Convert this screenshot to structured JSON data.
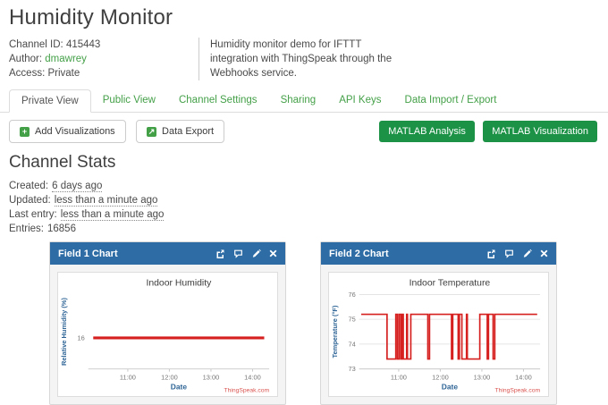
{
  "header": {
    "title": "Humidity Monitor",
    "channel_id_label": "Channel ID:",
    "channel_id": "415443",
    "author_label": "Author:",
    "author": "dmawrey",
    "access_label": "Access:",
    "access": "Private",
    "description": "Humidity monitor demo for IFTTT integration with ThingSpeak through the Webhooks service."
  },
  "tabs": [
    {
      "label": "Private View",
      "active": true
    },
    {
      "label": "Public View",
      "active": false
    },
    {
      "label": "Channel Settings",
      "active": false
    },
    {
      "label": "Sharing",
      "active": false
    },
    {
      "label": "API Keys",
      "active": false
    },
    {
      "label": "Data Import / Export",
      "active": false
    }
  ],
  "toolbar": {
    "add_visualizations_label": "Add Visualizations",
    "add_visualizations_icon": "plus-icon",
    "data_export_label": "Data Export",
    "data_export_icon": "export-icon",
    "export_glyph": "↗",
    "plus_glyph": "+",
    "matlab_analysis_label": "MATLAB Analysis",
    "matlab_visualization_label": "MATLAB Visualization"
  },
  "stats": {
    "heading": "Channel Stats",
    "rows": [
      {
        "label": "Created:",
        "value": "6 days ago"
      },
      {
        "label": "Updated:",
        "value": "less than a minute ago"
      },
      {
        "label": "Last entry:",
        "value": "less than a minute ago"
      },
      {
        "label": "Entries:",
        "value": "16856",
        "plain": true
      }
    ]
  },
  "panels": [
    {
      "title": "Field 1 Chart",
      "icons": [
        "popout-icon",
        "comment-icon",
        "edit-icon",
        "close-icon"
      ]
    },
    {
      "title": "Field 2 Chart",
      "icons": [
        "popout-icon",
        "comment-icon",
        "edit-icon",
        "close-icon"
      ]
    }
  ],
  "colors": {
    "accent_green": "#44a048",
    "button_green": "#1b9246",
    "panel_header_blue": "#2d6ca5",
    "chart_line_red": "#d62020",
    "axis_label_blue": "#2f6596",
    "credit_red": "#d9534f"
  },
  "chart_data": [
    {
      "type": "line",
      "title": "Indoor Humidity",
      "xlabel": "Date",
      "ylabel": "Relative Humidity (%)",
      "credit": "ThingSpeak.com",
      "xlim": [
        10.05,
        14.4
      ],
      "ylim": [
        14.75,
        17.75
      ],
      "x_ticks": [
        {
          "value": 11,
          "label": "11:00"
        },
        {
          "value": 12,
          "label": "12:00"
        },
        {
          "value": 13,
          "label": "13:00"
        },
        {
          "value": 14,
          "label": "14:00"
        }
      ],
      "y_ticks": [
        16
      ],
      "y_gridlines": [],
      "grid": false,
      "legend": "none",
      "line_color": "#d62020",
      "axis_color": "#2f6596",
      "credit_color": "#d9534f",
      "line_width": 3.2,
      "series": [
        {
          "name": "Relative Humidity (%)",
          "points": [
            [
              10.17,
              16
            ],
            [
              14.28,
              16
            ]
          ]
        }
      ]
    },
    {
      "type": "line",
      "title": "Indoor Temperature",
      "xlabel": "Date",
      "ylabel": "Temperature (°F)",
      "credit": "ThingSpeak.com",
      "xlim": [
        10.05,
        14.4
      ],
      "ylim": [
        73,
        76
      ],
      "x_ticks": [
        {
          "value": 11,
          "label": "11:00"
        },
        {
          "value": 12,
          "label": "12:00"
        },
        {
          "value": 13,
          "label": "13:00"
        },
        {
          "value": 14,
          "label": "14:00"
        }
      ],
      "y_ticks": [
        73,
        74,
        75,
        76
      ],
      "y_gridlines": [
        73,
        74,
        75,
        76
      ],
      "grid": true,
      "legend": "none",
      "line_color": "#d62020",
      "axis_color": "#2f6596",
      "credit_color": "#d9534f",
      "line_width": 1.7,
      "series": [
        {
          "name": "Temperature (°F)",
          "points": [
            [
              10.1,
              75.2
            ],
            [
              10.72,
              75.2
            ],
            [
              10.72,
              73.4
            ],
            [
              10.93,
              73.4
            ],
            [
              10.93,
              75.2
            ],
            [
              10.97,
              75.2
            ],
            [
              10.97,
              73.4
            ],
            [
              11.01,
              73.4
            ],
            [
              11.01,
              75.2
            ],
            [
              11.05,
              75.2
            ],
            [
              11.05,
              73.4
            ],
            [
              11.08,
              73.4
            ],
            [
              11.08,
              75.2
            ],
            [
              11.11,
              75.2
            ],
            [
              11.11,
              73.4
            ],
            [
              11.19,
              73.4
            ],
            [
              11.19,
              75.2
            ],
            [
              11.21,
              75.2
            ],
            [
              11.21,
              73.4
            ],
            [
              11.29,
              73.4
            ],
            [
              11.29,
              75.2
            ],
            [
              11.7,
              75.2
            ],
            [
              11.7,
              73.4
            ],
            [
              11.74,
              73.4
            ],
            [
              11.74,
              75.2
            ],
            [
              12.27,
              75.2
            ],
            [
              12.27,
              73.4
            ],
            [
              12.3,
              73.4
            ],
            [
              12.3,
              75.2
            ],
            [
              12.43,
              75.2
            ],
            [
              12.43,
              73.4
            ],
            [
              12.46,
              73.4
            ],
            [
              12.46,
              75.2
            ],
            [
              12.52,
              75.2
            ],
            [
              12.52,
              73.4
            ],
            [
              12.63,
              73.4
            ],
            [
              12.63,
              75.2
            ],
            [
              12.65,
              75.2
            ],
            [
              12.65,
              73.4
            ],
            [
              12.95,
              73.4
            ],
            [
              12.95,
              75.2
            ],
            [
              13.13,
              75.2
            ],
            [
              13.13,
              73.4
            ],
            [
              13.16,
              73.4
            ],
            [
              13.16,
              75.2
            ],
            [
              13.27,
              75.2
            ],
            [
              13.27,
              73.4
            ],
            [
              13.31,
              73.4
            ],
            [
              13.31,
              75.2
            ],
            [
              14.33,
              75.2
            ]
          ]
        }
      ]
    }
  ]
}
